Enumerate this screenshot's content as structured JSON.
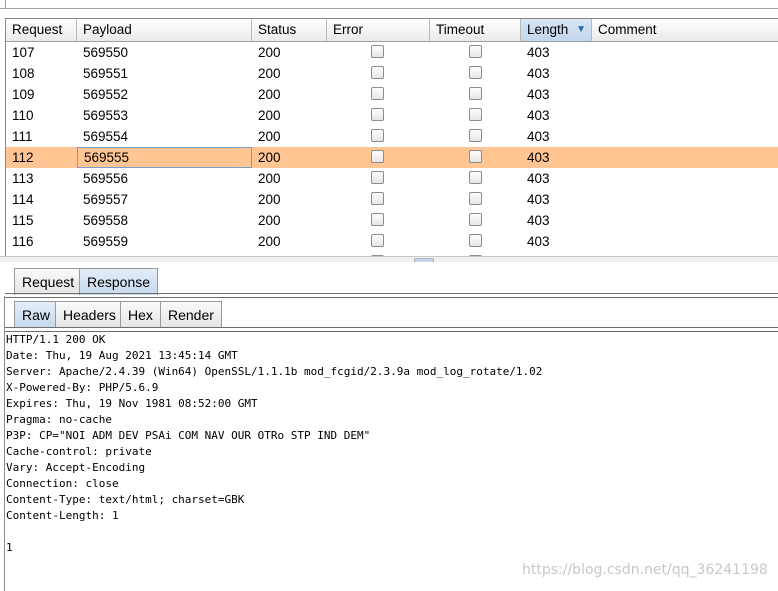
{
  "table": {
    "columns": [
      "Request",
      "Payload",
      "Status",
      "Error",
      "Timeout",
      "Length",
      "Comment"
    ],
    "sort_indicator": "▼",
    "rows": [
      {
        "request": "107",
        "payload": "569550",
        "status": "200",
        "length": "403"
      },
      {
        "request": "108",
        "payload": "569551",
        "status": "200",
        "length": "403"
      },
      {
        "request": "109",
        "payload": "569552",
        "status": "200",
        "length": "403"
      },
      {
        "request": "110",
        "payload": "569553",
        "status": "200",
        "length": "403"
      },
      {
        "request": "111",
        "payload": "569554",
        "status": "200",
        "length": "403"
      },
      {
        "request": "112",
        "payload": "569555",
        "status": "200",
        "length": "403"
      },
      {
        "request": "113",
        "payload": "569556",
        "status": "200",
        "length": "403"
      },
      {
        "request": "114",
        "payload": "569557",
        "status": "200",
        "length": "403"
      },
      {
        "request": "115",
        "payload": "569558",
        "status": "200",
        "length": "403"
      },
      {
        "request": "116",
        "payload": "569559",
        "status": "200",
        "length": "403"
      }
    ]
  },
  "message_tabs": {
    "request": "Request",
    "response": "Response"
  },
  "view_tabs": {
    "raw": "Raw",
    "headers": "Headers",
    "hex": "Hex",
    "render": "Render"
  },
  "response_text": "HTTP/1.1 200 OK\nDate: Thu, 19 Aug 2021 13:45:14 GMT\nServer: Apache/2.4.39 (Win64) OpenSSL/1.1.1b mod_fcgid/2.3.9a mod_log_rotate/1.02\nX-Powered-By: PHP/5.6.9\nExpires: Thu, 19 Nov 1981 08:52:00 GMT\nPragma: no-cache\nP3P: CP=\"NOI ADM DEV PSAi COM NAV OUR OTRo STP IND DEM\"\nCache-control: private\nVary: Accept-Encoding\nConnection: close\nContent-Type: text/html; charset=GBK\nContent-Length: 1\n\n1",
  "watermark": "https://blog.csdn.net/qq_36241198",
  "colors": {
    "selected_row": "#ffc593",
    "sorted_header": "#c3d6ec",
    "active_tab": "#c6d9ee"
  }
}
